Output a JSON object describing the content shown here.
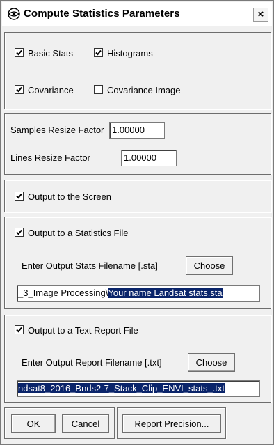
{
  "window": {
    "title": "Compute Statistics Parameters",
    "close_label": "×"
  },
  "stats_group": {
    "basic_stats": {
      "label": "Basic Stats",
      "checked": true
    },
    "histograms": {
      "label": "Histograms",
      "checked": true
    },
    "covariance": {
      "label": "Covariance",
      "checked": true
    },
    "covariance_image": {
      "label": "Covariance Image",
      "checked": false
    }
  },
  "resize_group": {
    "samples_label": "Samples Resize Factor",
    "samples_value": "1.00000",
    "lines_label": "Lines Resize Factor",
    "lines_value": "1.00000"
  },
  "screen_group": {
    "label": "Output to the Screen",
    "checked": true
  },
  "stats_file_group": {
    "label": "Output to a Statistics File",
    "checked": true,
    "filename_label": "Enter Output Stats Filename [.sta]",
    "choose_label": "Choose",
    "path_prefix": "​_3_Image Processing\\",
    "path_selected": "Your name Landsat stats.sta"
  },
  "report_file_group": {
    "label": "Output to a Text Report File",
    "checked": true,
    "filename_label": "Enter Output Report Filename [.txt]",
    "choose_label": "Choose",
    "path_selected": "ndsat8_2016_Bnds2-7_Stack_Clip_ENVI_stats_.txt"
  },
  "buttons": {
    "ok": "OK",
    "cancel": "Cancel",
    "report_precision": "Report Precision..."
  }
}
